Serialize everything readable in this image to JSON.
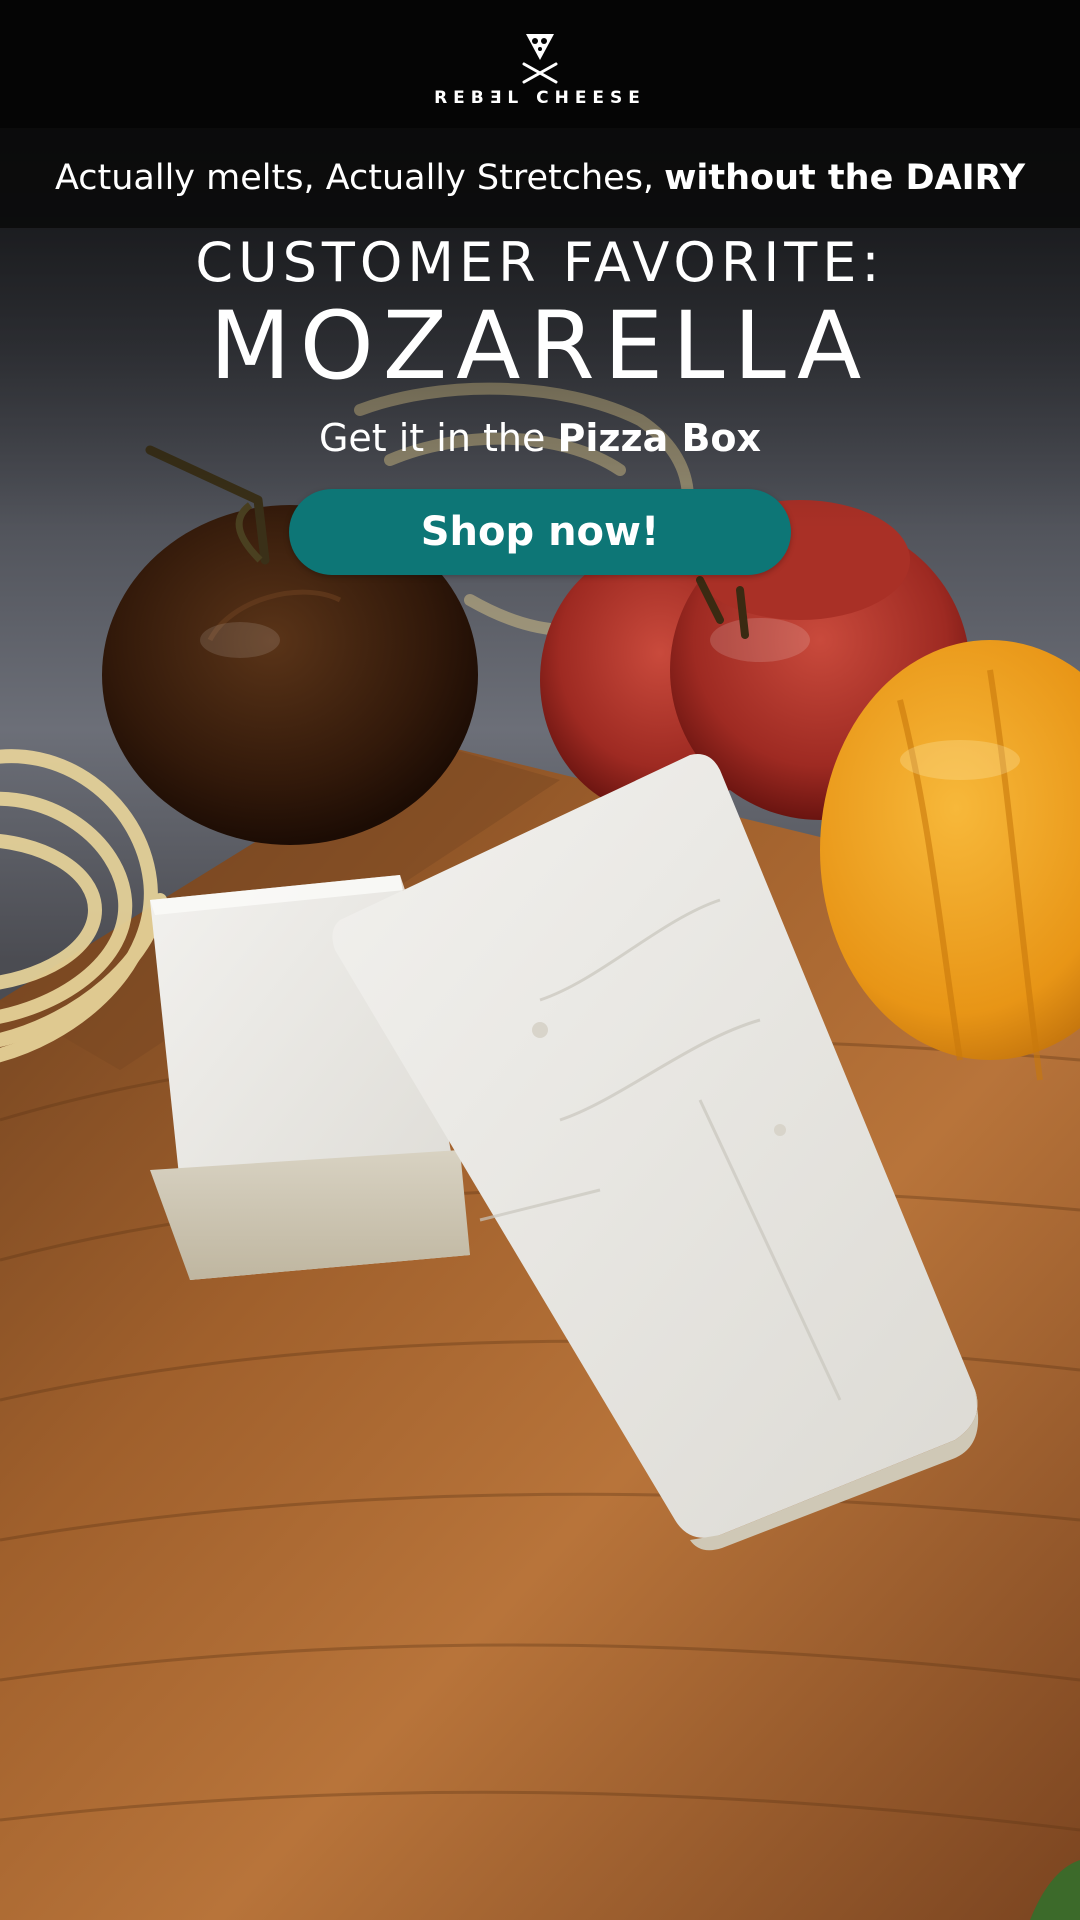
{
  "brand": {
    "name": "REBƎL CHEESE",
    "logo_icon": "pizza-skull-crossbones-icon"
  },
  "tagline": {
    "regular": "Actually melts, Actually Stretches,",
    "bold": "without the DAIRY"
  },
  "hero": {
    "headline_line1": "CUSTOMER FAVORITE:",
    "headline_line2": "MOZARELLA",
    "subline_regular": "Get it in the",
    "subline_bold": "Pizza Box"
  },
  "cta": {
    "label": "Shop now!",
    "color": "#0d7676"
  },
  "colors": {
    "header_bg": "#050505",
    "text": "#ffffff",
    "cutting_board": "#9a5a2a",
    "cheese": "#ecebe6"
  }
}
